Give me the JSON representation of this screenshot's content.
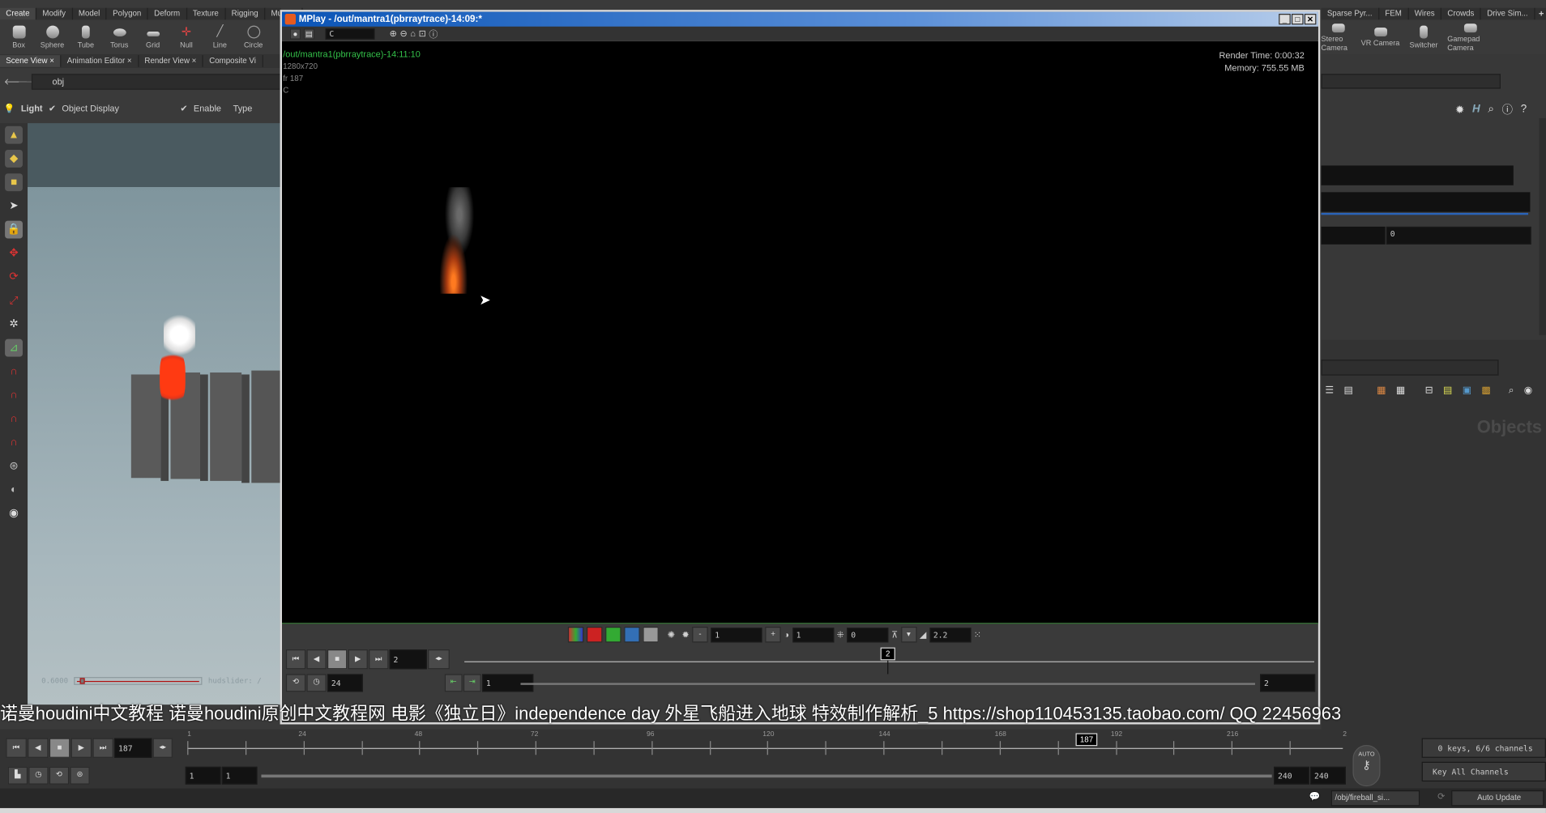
{
  "shelf": {
    "left_tabs": [
      "Create",
      "Modify",
      "Model",
      "Polygon",
      "Deform",
      "Texture",
      "Rigging",
      "Muscle"
    ],
    "left_tools": [
      "Box",
      "Sphere",
      "Tube",
      "Torus",
      "Grid",
      "Null",
      "Line",
      "Circle"
    ],
    "right_tabs": [
      "Sparse Pyr...",
      "FEM",
      "Wires",
      "Crowds",
      "Drive Sim..."
    ],
    "right_tools": [
      "Stereo Camera",
      "VR Camera",
      "Switcher",
      "Gamepad Camera"
    ]
  },
  "pane_tabs": [
    "Scene View",
    "Animation Editor",
    "Render View",
    "Composite Vi"
  ],
  "path": "obj",
  "viewport_toolbar": {
    "light": "Light",
    "object_display": "Object Display",
    "enable": "Enable",
    "type": "Type"
  },
  "viewport": {
    "hud_value": "0.6000",
    "hud_label": "hudslider: /",
    "hud_fraction": 0.03
  },
  "mplay": {
    "title": "MPlay - /out/mantra1(pbrraytrace)-14:09:*",
    "toolbar_channel": "C",
    "image_name": "/out/mantra1(pbrraytrace)-14:11:10",
    "resolution": "1280x720",
    "frame_info": "fr 187",
    "channel_info": "C",
    "render_time": "Render Time: 0:00:32",
    "memory": "Memory:   755.55 MB",
    "controls": {
      "exposure": "1",
      "gamma_field": "1",
      "offset": "0",
      "gamma": "2.2",
      "frame": "2",
      "fps": "24",
      "start": "1",
      "end": "2",
      "marker": "2"
    }
  },
  "subtitle": "诺曼houdini中文教程 诺曼houdini原创中文教程网 电影《独立日》independence day 外星飞船进入地球 特效制作解析_5    https://shop110453135.taobao.com/    QQ  22456963",
  "timeline": {
    "current_frame": "187",
    "ticks": [
      "1",
      "24",
      "48",
      "72",
      "96",
      "120",
      "144",
      "168",
      "192",
      "216",
      "2"
    ],
    "range_start": "1",
    "range_start2": "1",
    "range_end": "240",
    "range_end2": "240",
    "keys_info": "0 keys, 6/6 channels",
    "key_all": "Key All Channels",
    "auto_label": "AUTO"
  },
  "status": {
    "path": "/obj/fireball_si...",
    "auto_update": "Auto Update"
  },
  "right_panel": {
    "value_field": "0",
    "network_label": "Objects"
  },
  "colors": {
    "mplay_title": "#0a54b6",
    "image_text": "#34c24a",
    "fire": "#ff3a12"
  }
}
